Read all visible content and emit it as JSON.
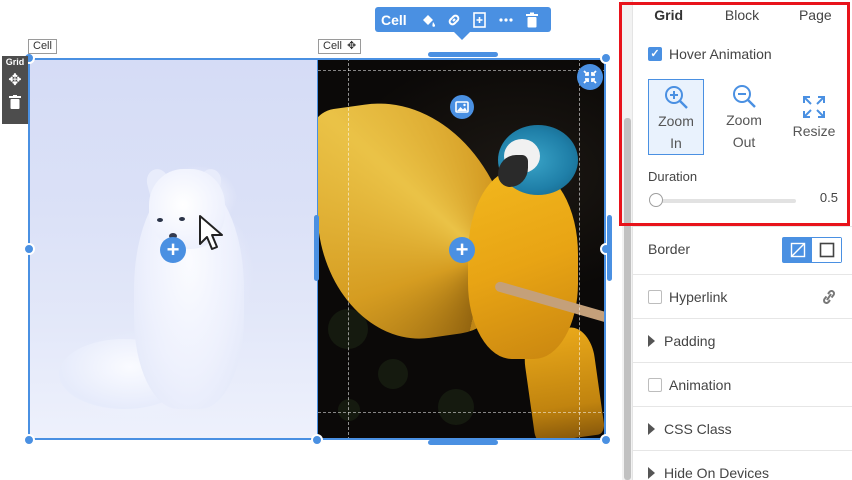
{
  "canvas": {
    "grid_tag": "Grid",
    "cell_left_tag": "Cell",
    "cell_right_tag": "Cell",
    "toolbar": {
      "label": "Cell",
      "icons": [
        "paint-bucket-icon",
        "link-icon",
        "add-column-icon",
        "more-icon",
        "trash-icon"
      ]
    },
    "accent_color": "#4a90e2"
  },
  "panel": {
    "tabs": [
      {
        "label": "Grid",
        "active": true
      },
      {
        "label": "Block",
        "active": false
      },
      {
        "label": "Page",
        "active": false
      }
    ],
    "hover_animation": {
      "label": "Hover Animation",
      "checked": true
    },
    "animation_options": [
      {
        "line1": "Zoom",
        "line2": "In",
        "icon": "zoom-in-icon",
        "selected": true
      },
      {
        "line1": "Zoom",
        "line2": "Out",
        "icon": "zoom-out-icon",
        "selected": false
      },
      {
        "line1": "Resize",
        "line2": "",
        "icon": "resize-icon",
        "selected": false
      }
    ],
    "duration": {
      "label": "Duration",
      "value": "0.5"
    },
    "border_label": "Border",
    "hyperlink": {
      "label": "Hyperlink",
      "checked": false
    },
    "padding_label": "Padding",
    "animation": {
      "label": "Animation",
      "checked": false
    },
    "css_class_label": "CSS Class",
    "hide_on_devices_label": "Hide On Devices",
    "highlight_color": "#e8131b"
  }
}
